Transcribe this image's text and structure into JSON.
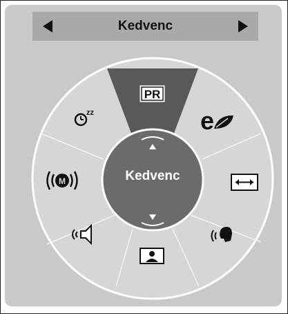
{
  "header": {
    "title": "Kedvenc"
  },
  "center": {
    "label": "Kedvenc"
  },
  "icons": {
    "pr_text": "PR",
    "sleep_text": "zz"
  }
}
